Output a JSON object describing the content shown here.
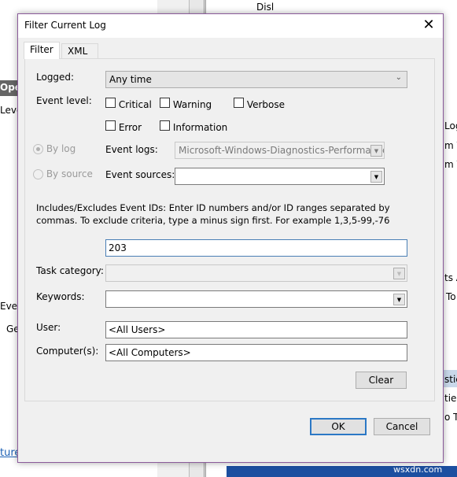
{
  "background": {
    "left_fragments": [
      "Oper",
      "Leve",
      "Even",
      "Ge"
    ],
    "right_fragments": [
      "Disl",
      "Log",
      "m V",
      "m V",
      "ts A",
      "To",
      "stic",
      "ties",
      "o T"
    ],
    "link_text": "tured image",
    "watermark": "wsxdn.com"
  },
  "dialog": {
    "title": "Filter Current Log",
    "close_icon": "close-icon",
    "tabs": [
      {
        "label": "Filter",
        "active": true
      },
      {
        "label": "XML",
        "active": false
      }
    ],
    "logged": {
      "label": "Logged:",
      "value": "Any time"
    },
    "event_level": {
      "label": "Event level:",
      "options": [
        {
          "label": "Critical",
          "checked": false
        },
        {
          "label": "Warning",
          "checked": false
        },
        {
          "label": "Verbose",
          "checked": false
        },
        {
          "label": "Error",
          "checked": false
        },
        {
          "label": "Information",
          "checked": false
        }
      ]
    },
    "by_log": {
      "label": "By log",
      "selected": true
    },
    "by_source": {
      "label": "By source",
      "selected": false
    },
    "event_logs": {
      "label": "Event logs:",
      "value": "Microsoft-Windows-Diagnostics-Performance"
    },
    "event_sources": {
      "label": "Event sources:",
      "value": ""
    },
    "instructions": "Includes/Excludes Event IDs: Enter ID numbers and/or ID ranges separated by commas. To exclude criteria, type a minus sign first. For example 1,3,5-99,-76",
    "event_ids": "203",
    "task_category": {
      "label": "Task category:",
      "value": ""
    },
    "keywords": {
      "label": "Keywords:",
      "value": ""
    },
    "user": {
      "label": "User:",
      "value": "<All Users>"
    },
    "computers": {
      "label": "Computer(s):",
      "value": "<All Computers>"
    },
    "clear_label": "Clear",
    "ok_label": "OK",
    "cancel_label": "Cancel"
  }
}
